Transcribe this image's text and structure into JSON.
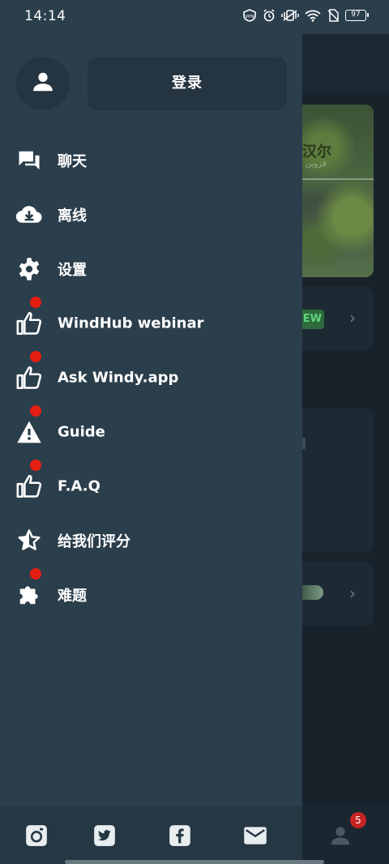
{
  "status_bar": {
    "time": "14:14",
    "icons": [
      "vpn-icon",
      "alarm-icon",
      "vibrate-icon",
      "wifi-icon",
      "sim-off-icon",
      "battery-icon"
    ],
    "battery_level": "97"
  },
  "drawer": {
    "avatar_icon": "user-icon",
    "login_label": "登录",
    "menu_items": [
      {
        "label": "聊天",
        "icon": "chat-icon",
        "badge": false
      },
      {
        "label": "离线",
        "icon": "cloud-download-icon",
        "badge": false
      },
      {
        "label": "设置",
        "icon": "gear-icon",
        "badge": false
      },
      {
        "label": "WindHub webinar",
        "icon": "thumbs-up-icon",
        "badge": true
      },
      {
        "label": "Ask Windy.app",
        "icon": "thumbs-up-icon",
        "badge": true
      },
      {
        "label": "Guide",
        "icon": "warning-icon",
        "badge": true
      },
      {
        "label": "F.A.Q",
        "icon": "thumbs-up-icon",
        "badge": true
      },
      {
        "label": "给我们评分",
        "icon": "star-rate-icon",
        "badge": false
      },
      {
        "label": "难题",
        "icon": "puzzle-icon",
        "badge": true
      }
    ],
    "social": [
      "instagram-icon",
      "twitter-icon",
      "facebook-icon",
      "mail-icon"
    ]
  },
  "background": {
    "map_text": "汉尔",
    "map_subtext": "قزوين",
    "badge_text": "EW",
    "profile_notification_count": "5"
  },
  "colors": {
    "drawer_bg": "#2b3e4c",
    "button_bg": "#243440",
    "badge_red": "#e41e12",
    "text": "#ffffff"
  }
}
